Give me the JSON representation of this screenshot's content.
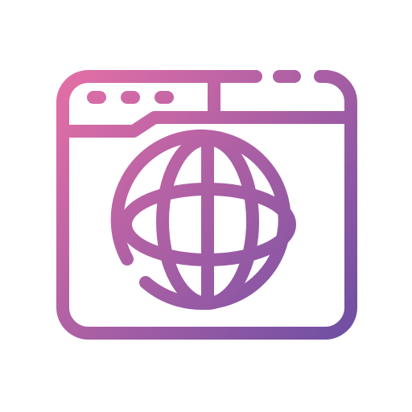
{
  "icon": {
    "name": "browser-globe-icon",
    "gradient_start": "#E56FA6",
    "gradient_end": "#6E4FA3"
  }
}
